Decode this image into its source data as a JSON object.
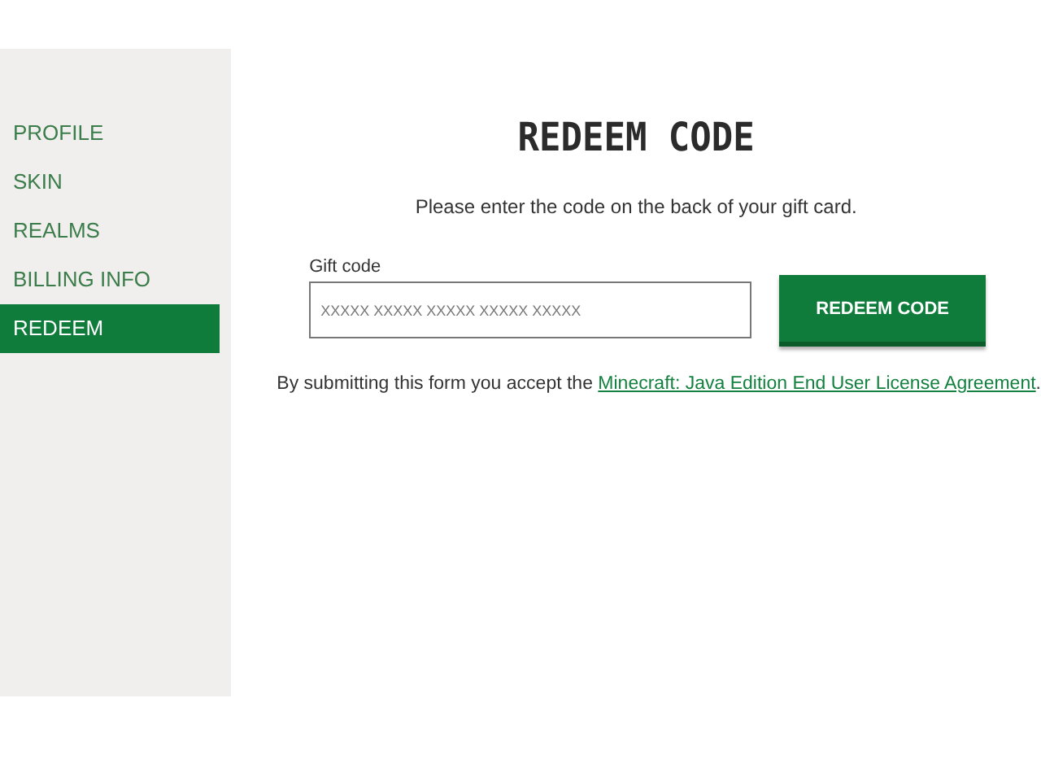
{
  "sidebar": {
    "items": [
      {
        "label": "PROFILE",
        "selected": false
      },
      {
        "label": "SKIN",
        "selected": false
      },
      {
        "label": "REALMS",
        "selected": false
      },
      {
        "label": "BILLING INFO",
        "selected": false
      },
      {
        "label": "REDEEM",
        "selected": true
      }
    ]
  },
  "main": {
    "title": "REDEEM CODE",
    "instruction": "Please enter the code on the back of your gift card.",
    "field": {
      "label": "Gift code",
      "placeholder": "XXXXX XXXXX XXXXX XXXXX XXXXX"
    },
    "button": "REDEEM CODE",
    "notice": {
      "text": "By submitting this form you accept the",
      "link": "Minecraft: Java Edition End User License Agreement",
      "end": "."
    }
  }
}
